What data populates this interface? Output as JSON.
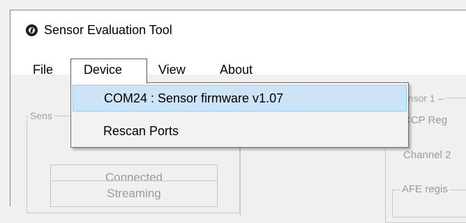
{
  "window": {
    "title": "Sensor Evaluation Tool",
    "icon": "app-logo-icon"
  },
  "menubar": {
    "items": [
      "File",
      "Device",
      "View",
      "About"
    ]
  },
  "device_menu": {
    "items": [
      {
        "label": "COM24  : Sensor firmware v1.07",
        "highlighted": true
      },
      {
        "label": "Rescan Ports",
        "highlighted": false
      }
    ]
  },
  "background": {
    "left_group_label": "Sens",
    "connected_button": "Connected",
    "streaming_button": "Streaming",
    "right_group_label": "ensor 1 –",
    "ccp_text": "CCP Reg",
    "channel_text": "Channel 2",
    "afe_text": "AFE regis"
  },
  "colors": {
    "highlight_bg": "#cce4f7",
    "highlight_border": "#99c9ef",
    "disabled_text": "#9a9a9a"
  }
}
